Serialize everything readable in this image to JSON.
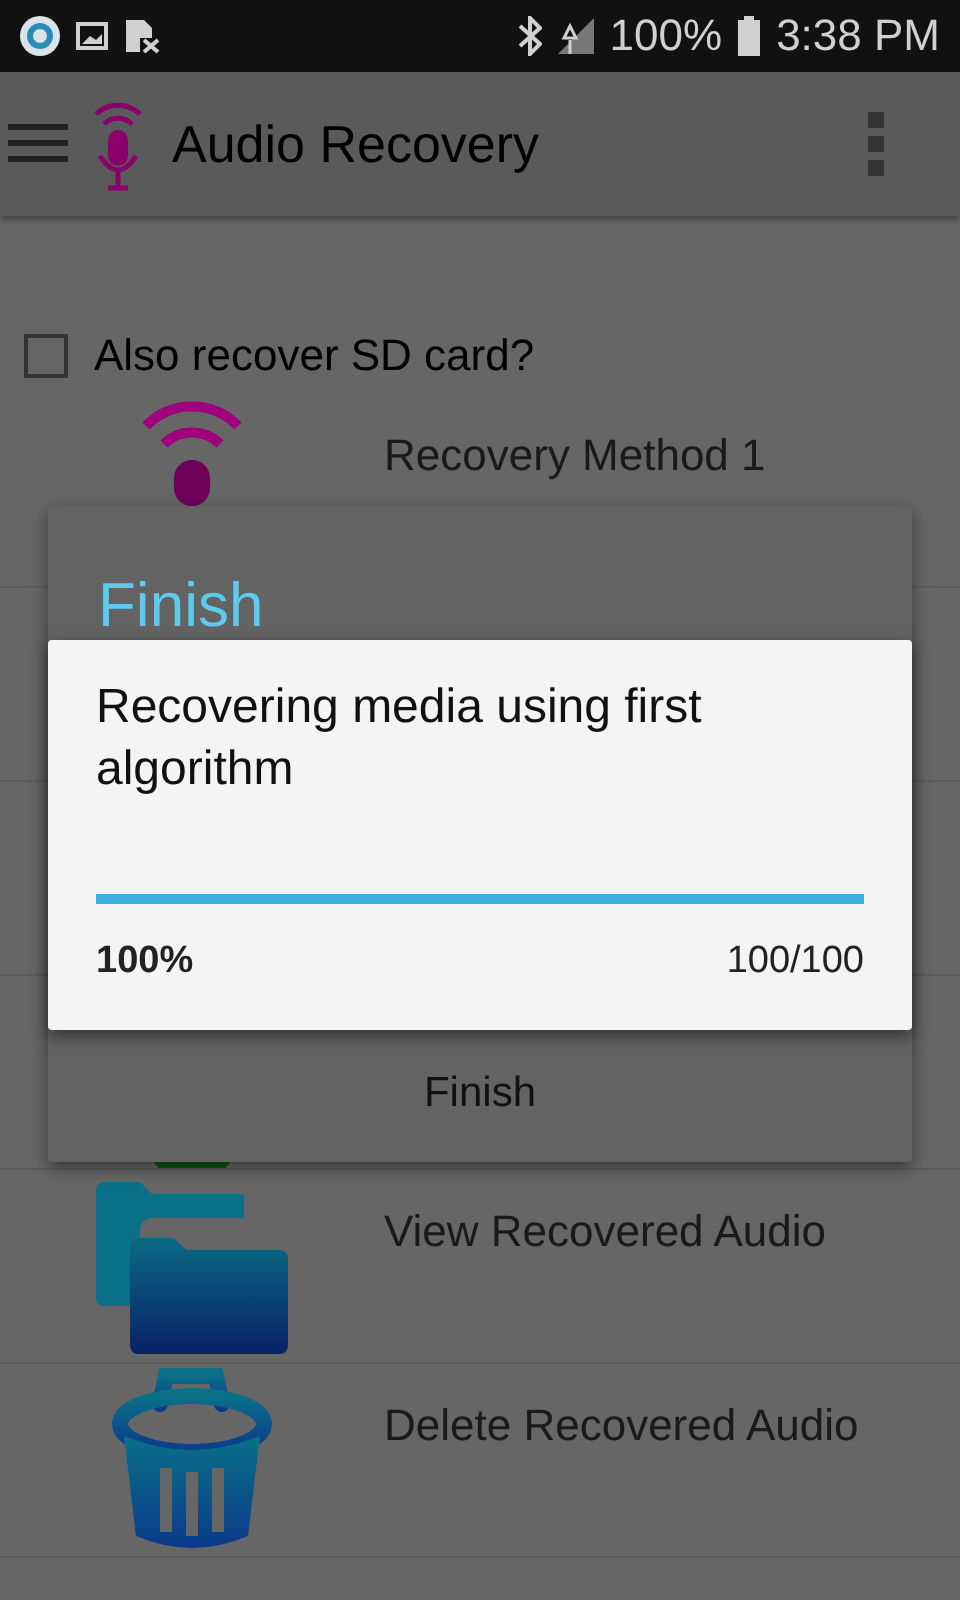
{
  "status_bar": {
    "battery_text": "100%",
    "time": "3:38 PM"
  },
  "toolbar": {
    "title": "Audio Recovery"
  },
  "sd_option": {
    "label": "Also recover SD card?",
    "checked": false
  },
  "rows": [
    {
      "kind": "wave-mic",
      "label": "Recovery Method 1"
    },
    {
      "kind": "covered"
    },
    {
      "kind": "covered"
    },
    {
      "kind": "green-circle"
    },
    {
      "kind": "folder",
      "label": "View Recovered Audio"
    },
    {
      "kind": "trash",
      "label": "Delete Recovered Audio"
    }
  ],
  "back_dialog": {
    "title": "Finish",
    "button": "Finish"
  },
  "progress_dialog": {
    "message": "Recovering media using first algorithm",
    "level": 1,
    "percent": "100%",
    "count": "100/100"
  }
}
